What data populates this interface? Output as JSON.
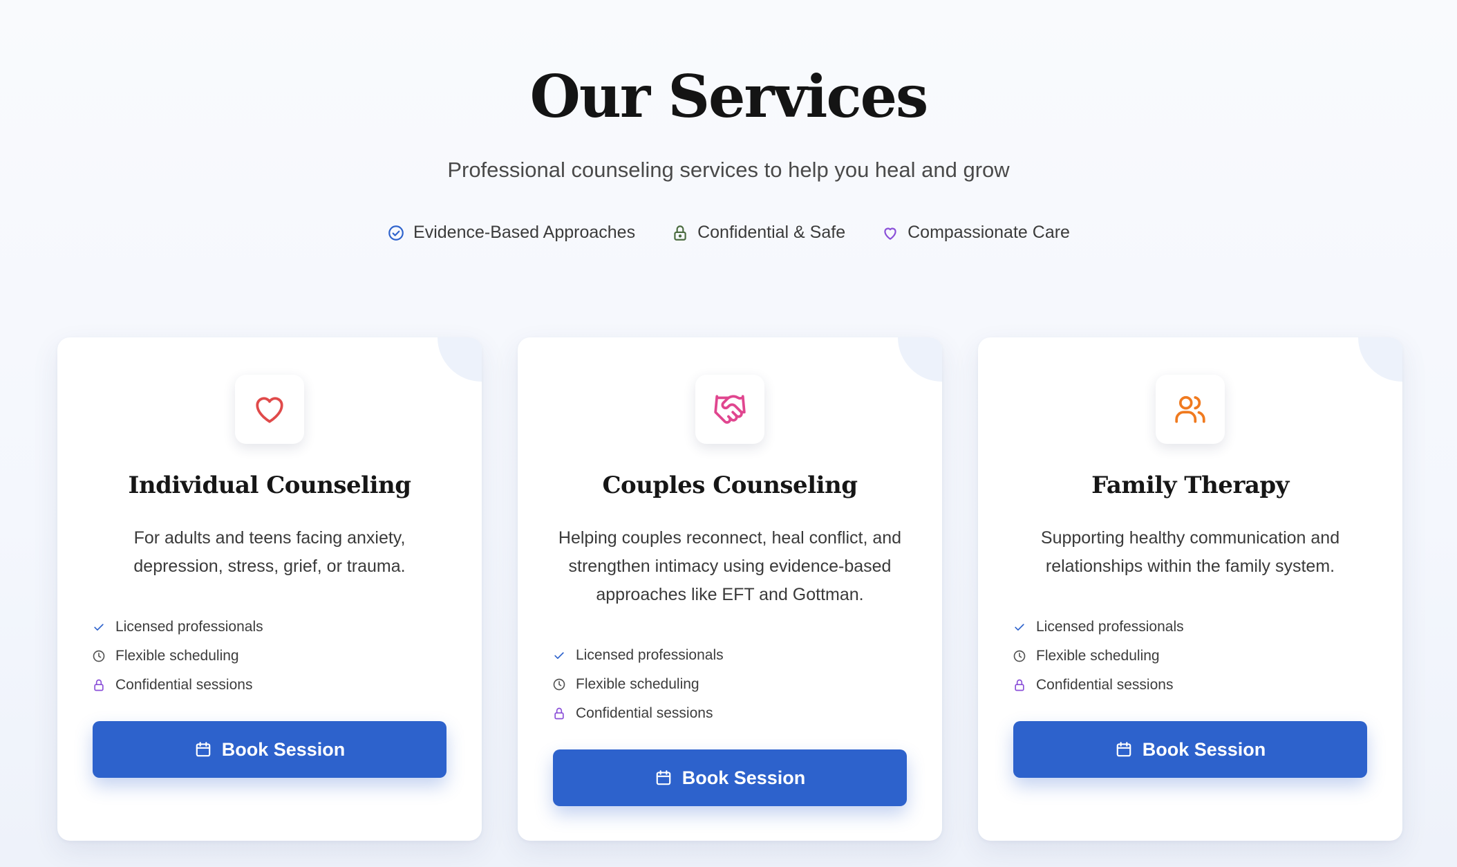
{
  "header": {
    "title": "Our Services",
    "subtitle": "Professional counseling services to help you heal and grow",
    "features": [
      {
        "label": "Evidence-Based Approaches",
        "icon": "check-circle-icon",
        "color": "#2d62cc"
      },
      {
        "label": "Confidential & Safe",
        "icon": "lock-icon",
        "color": "#4a6b3f"
      },
      {
        "label": "Compassionate Care",
        "icon": "heart-icon",
        "color": "#8a4fd8"
      }
    ]
  },
  "cards": [
    {
      "title": "Individual Counseling",
      "icon": "heart-icon",
      "icon_color": "#e04a4a",
      "description": "For adults and teens facing anxiety, depression, stress, grief, or trauma.",
      "features": [
        "Licensed professionals",
        "Flexible scheduling",
        "Confidential sessions"
      ],
      "button_label": "Book Session"
    },
    {
      "title": "Couples Counseling",
      "icon": "handshake-icon",
      "icon_color": "#e0468f",
      "description": "Helping couples reconnect, heal conflict, and strengthen intimacy using evidence-based approaches like EFT and Gottman.",
      "features": [
        "Licensed professionals",
        "Flexible scheduling",
        "Confidential sessions"
      ],
      "button_label": "Book Session"
    },
    {
      "title": "Family Therapy",
      "icon": "users-icon",
      "icon_color": "#f07a1f",
      "description": "Supporting healthy communication and relationships within the family system.",
      "features": [
        "Licensed professionals",
        "Flexible scheduling",
        "Confidential sessions"
      ],
      "button_label": "Book Session"
    }
  ],
  "feature_icons": [
    {
      "icon": "check-icon",
      "color": "#2d62cc"
    },
    {
      "icon": "clock-icon",
      "color": "#555555"
    },
    {
      "icon": "lock-icon",
      "color": "#8a4fd8"
    }
  ],
  "colors": {
    "accent": "#2d62cc",
    "card_bg": "#ffffff"
  }
}
